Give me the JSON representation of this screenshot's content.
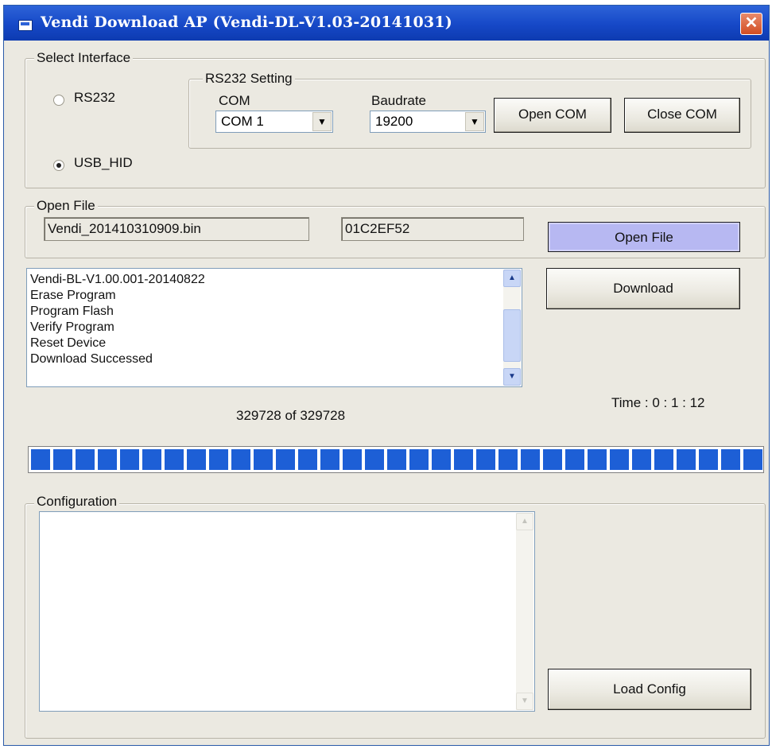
{
  "overlay_text": "",
  "window": {
    "title": "Vendi Download AP (Vendi-DL-V1.03-20141031)",
    "close_symbol": "✕"
  },
  "interface": {
    "group_label": "Select Interface",
    "rs232_label": "RS232",
    "usb_label": "USB_HID",
    "selected": "USB_HID",
    "rs232_setting": {
      "group_label": "RS232 Setting",
      "com_label": "COM",
      "com_value": "COM 1",
      "baud_label": "Baudrate",
      "baud_value": "19200",
      "open_com": "Open COM",
      "close_com": "Close COM"
    }
  },
  "open_file": {
    "group_label": "Open File",
    "filename": "Vendi_201410310909.bin",
    "checksum": "01C2EF52",
    "button": "Open File"
  },
  "log": {
    "lines": [
      "Vendi-BL-V1.00.001-20140822",
      "Erase Program",
      "Program Flash",
      "Verify Program",
      "Reset Device",
      "Download Successed"
    ]
  },
  "download_button": "Download",
  "time_text": "Time : 0 : 1 : 12",
  "progress": {
    "text": "329728 of  329728",
    "fraction": 1.0
  },
  "configuration": {
    "group_label": "Configuration",
    "text": "",
    "load_button": "Load Config"
  },
  "colors": {
    "titlebar": "#1648c7",
    "progress": "#1d5fd6",
    "open_file_button": "#b7b8f2"
  }
}
